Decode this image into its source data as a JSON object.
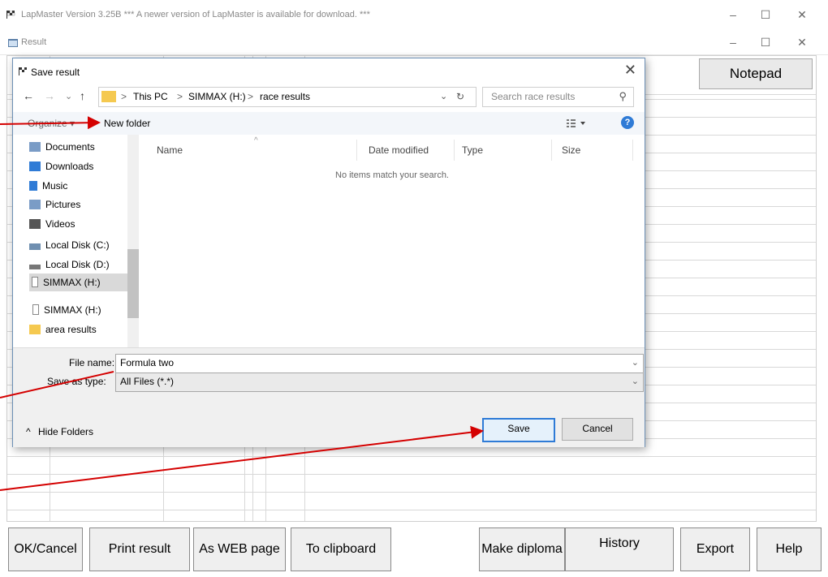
{
  "app": {
    "title": "LapMaster Version 3.25B   *** A newer version of LapMaster is available for download. ***",
    "result_window_title": "Result",
    "notepad_label": "Notepad"
  },
  "dialog": {
    "title": "Save result",
    "close_glyph": "✕",
    "nav": {
      "back": "←",
      "forward": "→",
      "recent": "⌄",
      "up": "↑",
      "breadcrumb": [
        "This PC",
        "SIMMAX (H:)",
        "race results"
      ],
      "separator": ">",
      "refresh": "↻",
      "dropdown": "⌄",
      "search_placeholder": "Search race results",
      "search_icon": "⚲"
    },
    "toolbar": {
      "organize_label": "Organize ▾",
      "new_folder_label": "New folder",
      "view_icon": "view-options-icon",
      "help_icon": "?"
    },
    "nav_pane": {
      "items": [
        {
          "label": "Documents",
          "icon": "documents-icon",
          "color": "#7a9cc6"
        },
        {
          "label": "Downloads",
          "icon": "downloads-icon",
          "color": "#2f7bd6"
        },
        {
          "label": "Music",
          "icon": "music-icon",
          "color": "#2f7bd6"
        },
        {
          "label": "Pictures",
          "icon": "pictures-icon",
          "color": "#7a9cc6"
        },
        {
          "label": "Videos",
          "icon": "videos-icon",
          "color": "#555555"
        },
        {
          "label": "Local Disk (C:)",
          "icon": "drive-icon",
          "color": "#6f8fb0"
        },
        {
          "label": "Local Disk (D:)",
          "icon": "drive-icon",
          "color": "#777777"
        },
        {
          "label": "SIMMAX (H:)",
          "icon": "usb-drive-icon",
          "color": "#888888",
          "selected": true
        },
        {
          "label": "SIMMAX (H:)",
          "icon": "usb-drive-icon",
          "color": "#888888"
        },
        {
          "label": "area results",
          "icon": "folder-icon",
          "color": "#f5c950"
        }
      ]
    },
    "file_list": {
      "columns": [
        "Name",
        "Date modified",
        "Type",
        "Size"
      ],
      "empty_message": "No items match your search."
    },
    "bottom": {
      "file_name_label": "File name:",
      "file_name_value": "Formula two",
      "save_type_label": "Save as type:",
      "save_type_value": "All Files (*.*)",
      "hide_folders_label": "Hide Folders",
      "save_label": "Save",
      "cancel_label": "Cancel"
    }
  },
  "bottom_buttons": {
    "ok_cancel": "OK/Cancel",
    "print_result": "Print result",
    "as_web_page": "As WEB page",
    "to_clipboard": "To clipboard",
    "make_diploma": "Make diploma",
    "history": "History",
    "export": "Export",
    "help": "Help"
  },
  "colors": {
    "annotation_arrow": "#d40000",
    "accent": "#2f7bd6",
    "folder": "#f5c950"
  }
}
